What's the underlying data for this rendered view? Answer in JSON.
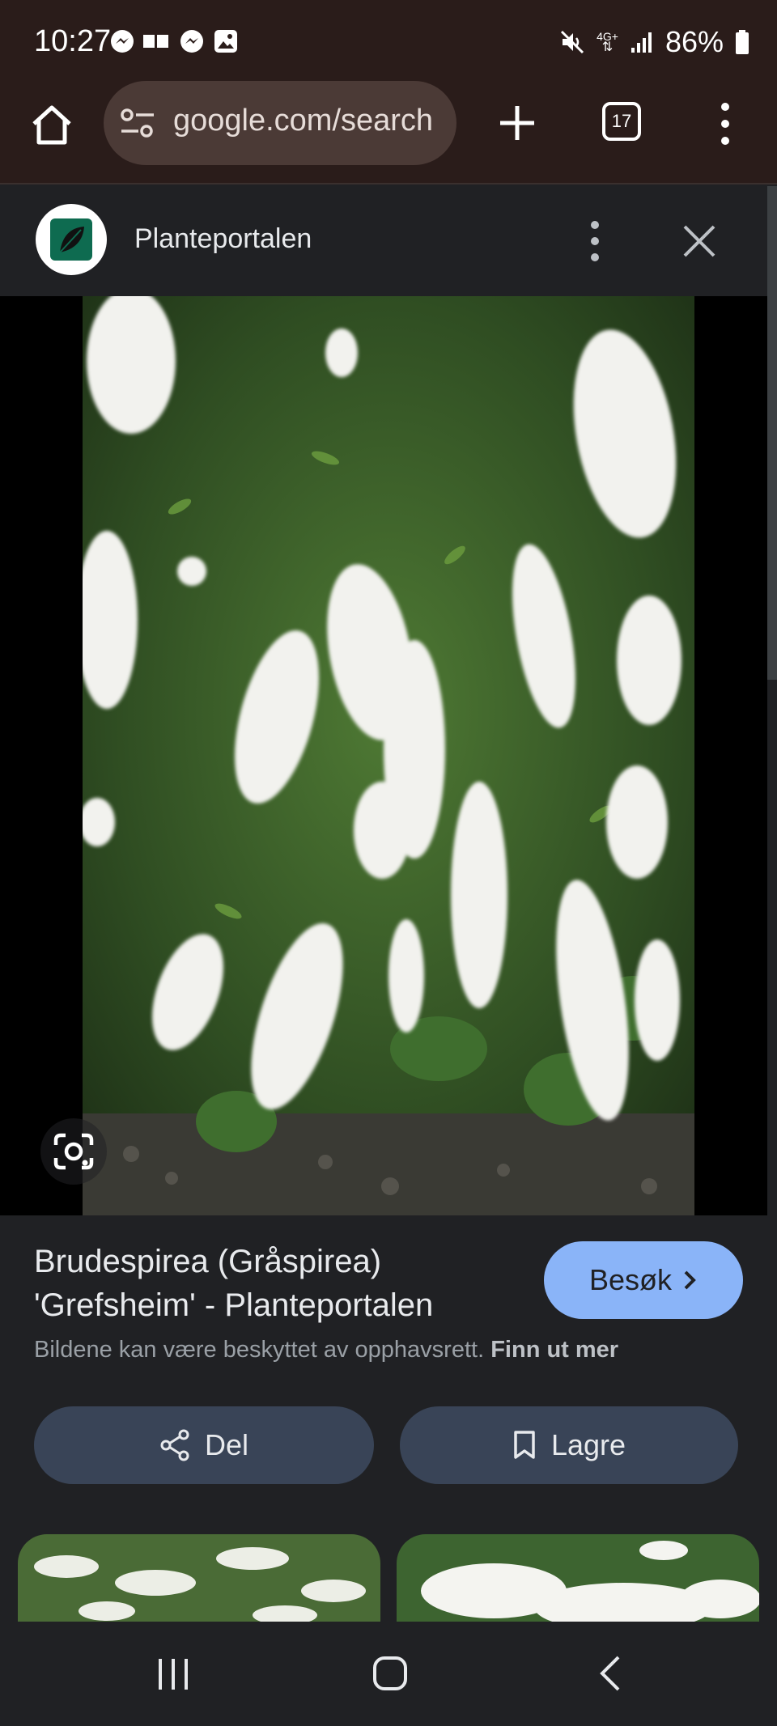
{
  "status_bar": {
    "time": "10:27",
    "battery": "86%",
    "network": "4G+",
    "icons": [
      "messenger-icon",
      "card-icon",
      "messenger-icon",
      "gallery-icon",
      "mute-icon",
      "signal-icon",
      "battery-icon"
    ]
  },
  "browser": {
    "url": "google.com/search",
    "tab_count": "17"
  },
  "sheet": {
    "site_name": "Planteportalen",
    "logo_icon": "leaf-icon"
  },
  "result": {
    "title_line1": "Brudespirea (Gråspirea)",
    "title_line2": "'Grefsheim' - Planteportalen",
    "visit_label": "Besøk",
    "copyright_text": "Bildene kan være beskyttet av opphavsrett.",
    "copyright_link": "Finn ut mer",
    "share_label": "Del",
    "save_label": "Lagre"
  },
  "colors": {
    "accent": "#8ab4f8",
    "action_button": "#394457",
    "background": "#202124",
    "toolbar": "#2a1c1a"
  }
}
